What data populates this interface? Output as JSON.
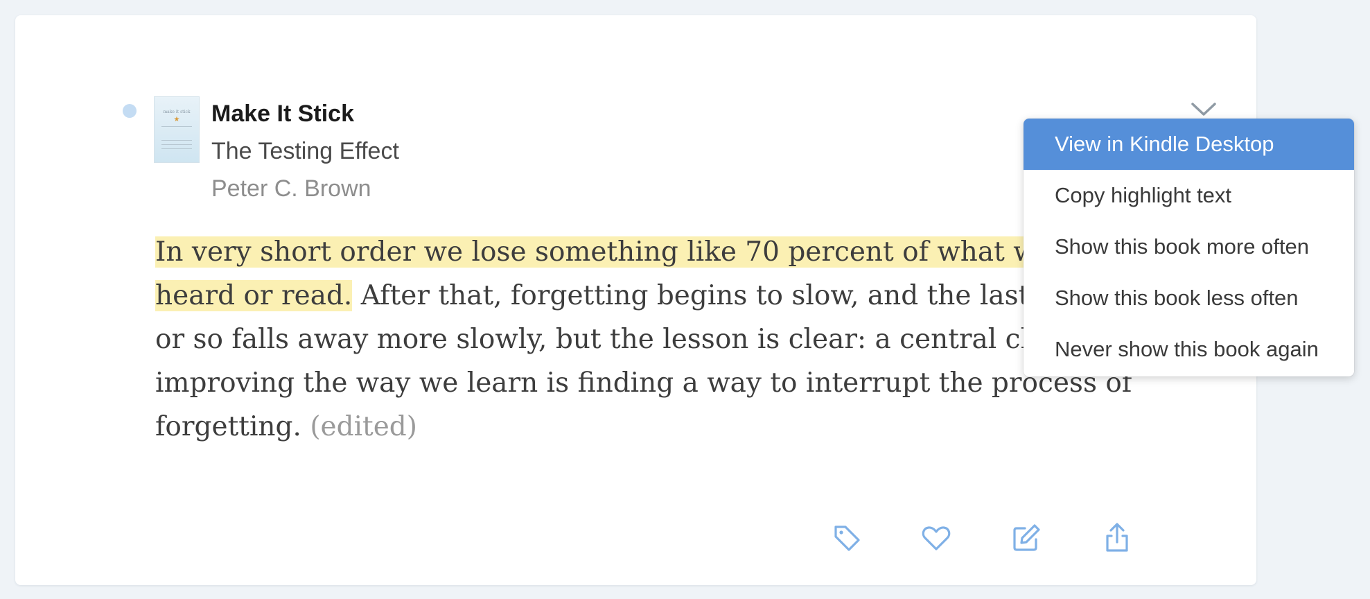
{
  "book": {
    "title": "Make It Stick",
    "chapter": "The Testing Effect",
    "author": "Peter C. Brown"
  },
  "highlight": {
    "lines": [
      {
        "marked": "In very short order we lose something like 70 percent of what we’ve just",
        "rest": ""
      },
      {
        "marked": "heard or read.",
        "rest": " After that, forgetting begins to slow, and the last 30 percent"
      },
      {
        "marked": "",
        "rest": "or so falls away more slowly, but the lesson is clear: a central challenge to"
      },
      {
        "marked": "",
        "rest": "improving the way we learn is finding a way to interrupt the process of"
      },
      {
        "marked": "",
        "rest": "forgetting."
      }
    ],
    "edited_label": "(edited)"
  },
  "actions": [
    {
      "icon": "tag-icon"
    },
    {
      "icon": "heart-icon"
    },
    {
      "icon": "edit-icon"
    },
    {
      "icon": "share-icon"
    }
  ],
  "menu": {
    "items": [
      {
        "label": "View in Kindle Desktop",
        "active": true
      },
      {
        "label": "Copy highlight text"
      },
      {
        "label": "Show this book more often"
      },
      {
        "label": "Show this book less often"
      },
      {
        "label": "Never show this book again"
      }
    ]
  },
  "colors": {
    "accent": "#558fd9",
    "icon": "#7fb0e6",
    "highlight": "#fbf0b3",
    "background": "#eff3f7"
  }
}
